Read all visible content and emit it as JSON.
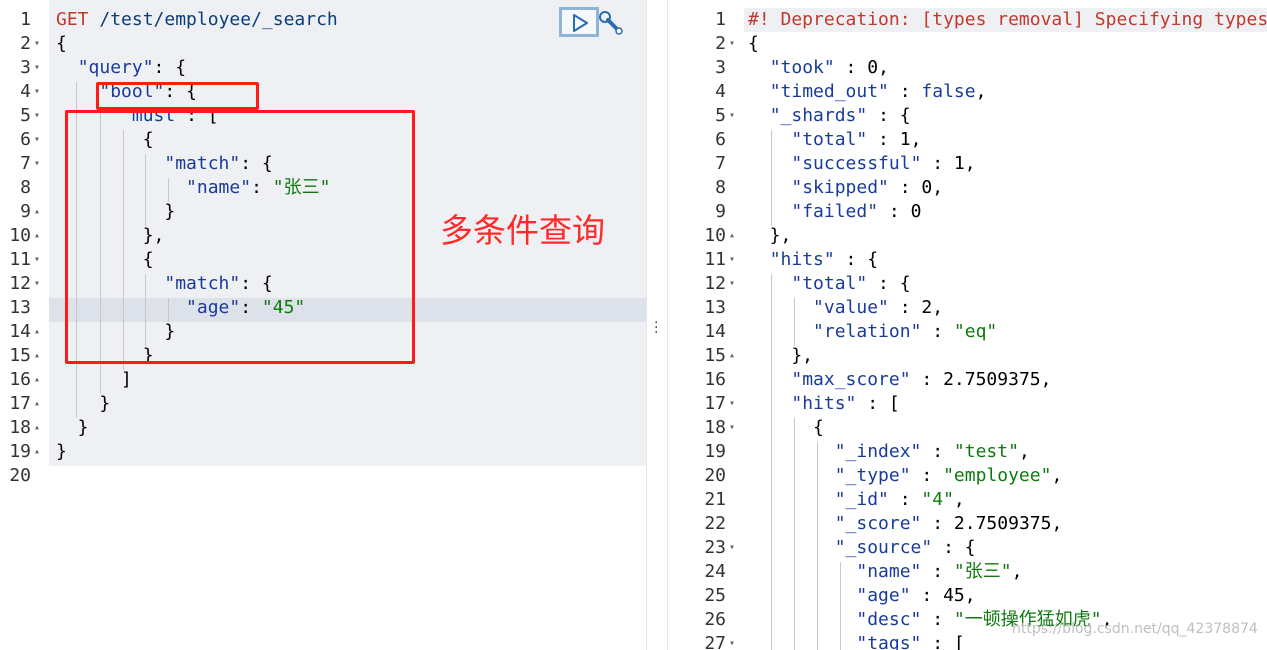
{
  "request": {
    "method": "GET",
    "path": "/test/employee/_search",
    "lines": [
      {
        "n": "1",
        "fold": "",
        "parts": [
          [
            "kw",
            "GET"
          ],
          [
            "",
            " "
          ],
          [
            "n",
            "/test/employee/_search"
          ]
        ]
      },
      {
        "n": "2",
        "fold": "▾",
        "parts": [
          [
            "",
            "{"
          ]
        ]
      },
      {
        "n": "3",
        "fold": "▾",
        "parts": [
          [
            "",
            "  "
          ],
          [
            "b",
            "\"query\""
          ],
          [
            "",
            ": {"
          ]
        ]
      },
      {
        "n": "4",
        "fold": "▾",
        "parts": [
          [
            "",
            "    "
          ],
          [
            "b",
            "\"bool\""
          ],
          [
            "",
            ": {"
          ]
        ]
      },
      {
        "n": "5",
        "fold": "▾",
        "parts": [
          [
            "",
            "      "
          ],
          [
            "b",
            "\"must\""
          ],
          [
            "",
            ": ["
          ]
        ]
      },
      {
        "n": "6",
        "fold": "▾",
        "parts": [
          [
            "",
            "        {"
          ]
        ]
      },
      {
        "n": "7",
        "fold": "▾",
        "parts": [
          [
            "",
            "          "
          ],
          [
            "b",
            "\"match\""
          ],
          [
            "",
            ": {"
          ]
        ]
      },
      {
        "n": "8",
        "fold": "",
        "parts": [
          [
            "",
            "            "
          ],
          [
            "b",
            "\"name\""
          ],
          [
            "",
            ": "
          ],
          [
            "s",
            "\"张三\""
          ]
        ]
      },
      {
        "n": "9",
        "fold": "▴",
        "parts": [
          [
            "",
            "          }"
          ]
        ]
      },
      {
        "n": "10",
        "fold": "▴",
        "parts": [
          [
            "",
            "        },"
          ]
        ]
      },
      {
        "n": "11",
        "fold": "▾",
        "parts": [
          [
            "",
            "        {"
          ]
        ]
      },
      {
        "n": "12",
        "fold": "▾",
        "parts": [
          [
            "",
            "          "
          ],
          [
            "b",
            "\"match\""
          ],
          [
            "",
            ": {"
          ]
        ]
      },
      {
        "n": "13",
        "fold": "",
        "parts": [
          [
            "",
            "            "
          ],
          [
            "b",
            "\"age\""
          ],
          [
            "",
            ": "
          ],
          [
            "s",
            "\"45\""
          ]
        ]
      },
      {
        "n": "14",
        "fold": "▴",
        "parts": [
          [
            "",
            "          }"
          ]
        ]
      },
      {
        "n": "15",
        "fold": "▴",
        "parts": [
          [
            "",
            "        }"
          ]
        ]
      },
      {
        "n": "16",
        "fold": "▴",
        "parts": [
          [
            "",
            "      ]"
          ]
        ]
      },
      {
        "n": "17",
        "fold": "▴",
        "parts": [
          [
            "",
            "    }"
          ]
        ]
      },
      {
        "n": "18",
        "fold": "▴",
        "parts": [
          [
            "",
            "  }"
          ]
        ]
      },
      {
        "n": "19",
        "fold": "▴",
        "parts": [
          [
            "",
            "}"
          ]
        ]
      },
      {
        "n": "20",
        "fold": "",
        "parts": []
      }
    ]
  },
  "annotation": "多条件查询",
  "response": {
    "lines": [
      {
        "n": "1",
        "fold": "",
        "parts": [
          [
            "m",
            "#! Deprecation: [types removal] Specifying types in search requests is deprecated."
          ]
        ]
      },
      {
        "n": "2",
        "fold": "▾",
        "parts": [
          [
            "",
            "{"
          ]
        ]
      },
      {
        "n": "3",
        "fold": "",
        "parts": [
          [
            "",
            "  "
          ],
          [
            "b",
            "\"took\""
          ],
          [
            "",
            " : 0,"
          ]
        ]
      },
      {
        "n": "4",
        "fold": "",
        "parts": [
          [
            "",
            "  "
          ],
          [
            "b",
            "\"timed_out\""
          ],
          [
            "",
            " : "
          ],
          [
            "b",
            "false"
          ],
          [
            "",
            ","
          ]
        ]
      },
      {
        "n": "5",
        "fold": "▾",
        "parts": [
          [
            "",
            "  "
          ],
          [
            "b",
            "\"_shards\""
          ],
          [
            "",
            " : {"
          ]
        ]
      },
      {
        "n": "6",
        "fold": "",
        "parts": [
          [
            "",
            "    "
          ],
          [
            "b",
            "\"total\""
          ],
          [
            "",
            " : 1,"
          ]
        ]
      },
      {
        "n": "7",
        "fold": "",
        "parts": [
          [
            "",
            "    "
          ],
          [
            "b",
            "\"successful\""
          ],
          [
            "",
            " : 1,"
          ]
        ]
      },
      {
        "n": "8",
        "fold": "",
        "parts": [
          [
            "",
            "    "
          ],
          [
            "b",
            "\"skipped\""
          ],
          [
            "",
            " : 0,"
          ]
        ]
      },
      {
        "n": "9",
        "fold": "",
        "parts": [
          [
            "",
            "    "
          ],
          [
            "b",
            "\"failed\""
          ],
          [
            "",
            " : 0"
          ]
        ]
      },
      {
        "n": "10",
        "fold": "▴",
        "parts": [
          [
            "",
            "  },"
          ]
        ]
      },
      {
        "n": "11",
        "fold": "▾",
        "parts": [
          [
            "",
            "  "
          ],
          [
            "b",
            "\"hits\""
          ],
          [
            "",
            " : {"
          ]
        ]
      },
      {
        "n": "12",
        "fold": "▾",
        "parts": [
          [
            "",
            "    "
          ],
          [
            "b",
            "\"total\""
          ],
          [
            "",
            " : {"
          ]
        ]
      },
      {
        "n": "13",
        "fold": "",
        "parts": [
          [
            "",
            "      "
          ],
          [
            "b",
            "\"value\""
          ],
          [
            "",
            " : 2,"
          ]
        ]
      },
      {
        "n": "14",
        "fold": "",
        "parts": [
          [
            "",
            "      "
          ],
          [
            "b",
            "\"relation\""
          ],
          [
            "",
            " : "
          ],
          [
            "s",
            "\"eq\""
          ]
        ]
      },
      {
        "n": "15",
        "fold": "▴",
        "parts": [
          [
            "",
            "    },"
          ]
        ]
      },
      {
        "n": "16",
        "fold": "",
        "parts": [
          [
            "",
            "    "
          ],
          [
            "b",
            "\"max_score\""
          ],
          [
            "",
            " : 2.7509375,"
          ]
        ]
      },
      {
        "n": "17",
        "fold": "▾",
        "parts": [
          [
            "",
            "    "
          ],
          [
            "b",
            "\"hits\""
          ],
          [
            "",
            " : ["
          ]
        ]
      },
      {
        "n": "18",
        "fold": "▾",
        "parts": [
          [
            "",
            "      {"
          ]
        ]
      },
      {
        "n": "19",
        "fold": "",
        "parts": [
          [
            "",
            "        "
          ],
          [
            "b",
            "\"_index\""
          ],
          [
            "",
            " : "
          ],
          [
            "s",
            "\"test\""
          ],
          [
            "",
            ","
          ]
        ]
      },
      {
        "n": "20",
        "fold": "",
        "parts": [
          [
            "",
            "        "
          ],
          [
            "b",
            "\"_type\""
          ],
          [
            "",
            " : "
          ],
          [
            "s",
            "\"employee\""
          ],
          [
            "",
            ","
          ]
        ]
      },
      {
        "n": "21",
        "fold": "",
        "parts": [
          [
            "",
            "        "
          ],
          [
            "b",
            "\"_id\""
          ],
          [
            "",
            " : "
          ],
          [
            "s",
            "\"4\""
          ],
          [
            "",
            ","
          ]
        ]
      },
      {
        "n": "22",
        "fold": "",
        "parts": [
          [
            "",
            "        "
          ],
          [
            "b",
            "\"_score\""
          ],
          [
            "",
            " : 2.7509375,"
          ]
        ]
      },
      {
        "n": "23",
        "fold": "▾",
        "parts": [
          [
            "",
            "        "
          ],
          [
            "b",
            "\"_source\""
          ],
          [
            "",
            " : {"
          ]
        ]
      },
      {
        "n": "24",
        "fold": "",
        "parts": [
          [
            "",
            "          "
          ],
          [
            "b",
            "\"name\""
          ],
          [
            "",
            " : "
          ],
          [
            "s",
            "\"张三\""
          ],
          [
            "",
            ","
          ]
        ]
      },
      {
        "n": "25",
        "fold": "",
        "parts": [
          [
            "",
            "          "
          ],
          [
            "b",
            "\"age\""
          ],
          [
            "",
            " : 45,"
          ]
        ]
      },
      {
        "n": "26",
        "fold": "",
        "parts": [
          [
            "",
            "          "
          ],
          [
            "b",
            "\"desc\""
          ],
          [
            "",
            " : "
          ],
          [
            "s",
            "\"一顿操作猛如虎\""
          ],
          [
            "",
            ","
          ]
        ]
      },
      {
        "n": "27",
        "fold": "▾",
        "parts": [
          [
            "",
            "          "
          ],
          [
            "b",
            "\"tags\""
          ],
          [
            "",
            " : ["
          ]
        ]
      }
    ]
  },
  "watermark": "https://blog.csdn.net/qq_42378874",
  "icons": {
    "run": "play-icon",
    "settings": "wrench-icon",
    "resize": "drag-handle-icon"
  }
}
